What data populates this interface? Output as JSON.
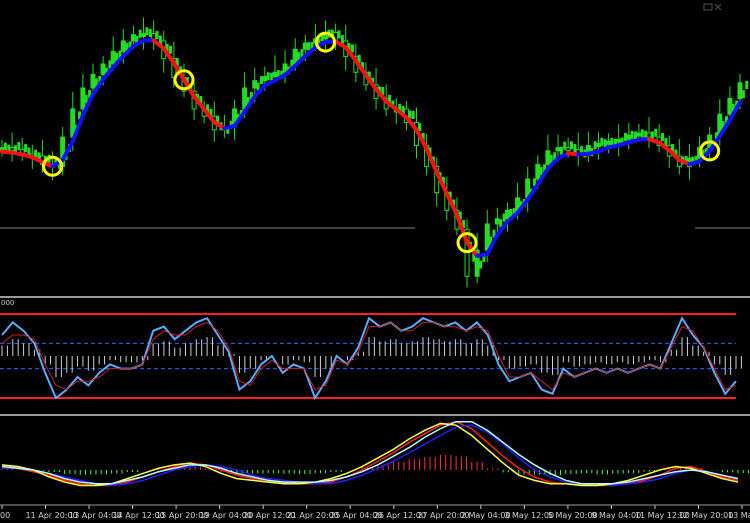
{
  "chart_data": [
    {
      "type": "candlestick",
      "panel": "price",
      "trend_line_colors": {
        "up": "#1010ff",
        "down": "#ff1010"
      },
      "candle_colors": {
        "bull": "#22dd22",
        "bear": "#22dd22"
      },
      "level_line_color": "#808080",
      "signal_marker_color": "#ffff00",
      "signal_markers_at_index": [
        5,
        18,
        32,
        46,
        70
      ],
      "series": [
        {
          "name": "close",
          "values": [
            168,
            166,
            162,
            160,
            152,
            150,
            178,
            205,
            225,
            238,
            248,
            260,
            270,
            276,
            277,
            270,
            253,
            235,
            222,
            205,
            198,
            185,
            188,
            205,
            225,
            232,
            236,
            240,
            248,
            262,
            268,
            272,
            278,
            270,
            255,
            240,
            228,
            215,
            205,
            205,
            192,
            170,
            150,
            125,
            108,
            90,
            45,
            70,
            95,
            100,
            108,
            120,
            138,
            152,
            165,
            168,
            166,
            162,
            170,
            172,
            174,
            176,
            180,
            182,
            178,
            170,
            160,
            150,
            158,
            168,
            180,
            200,
            215,
            230
          ]
        }
      ]
    },
    {
      "type": "line",
      "panel": "oscillator",
      "scale_label": "000",
      "overbought_line_color": "#ff2020",
      "dashed_level_color": "#3060ff",
      "series": [
        {
          "name": "",
          "color": "#5aaaff",
          "values": [
            0.5,
            0.8,
            0.6,
            0.3,
            -0.4,
            -1.0,
            -0.8,
            -0.5,
            -0.7,
            -0.4,
            -0.2,
            -0.3,
            -0.3,
            -0.2,
            0.6,
            0.7,
            0.4,
            0.6,
            0.8,
            0.9,
            0.5,
            0.1,
            -0.8,
            -0.6,
            -0.2,
            0.0,
            -0.4,
            -0.2,
            -0.3,
            -1.0,
            -0.6,
            0.0,
            -0.2,
            0.2,
            0.9,
            0.7,
            0.8,
            0.6,
            0.7,
            0.9,
            0.8,
            0.7,
            0.8,
            0.6,
            0.8,
            0.5,
            -0.2,
            -0.6,
            -0.5,
            -0.4,
            -0.8,
            -0.9,
            -0.3,
            -0.5,
            -0.4,
            -0.3,
            -0.4,
            -0.3,
            -0.4,
            -0.3,
            -0.2,
            -0.3,
            0.3,
            0.9,
            0.5,
            0.2,
            -0.4,
            -0.9,
            -0.6
          ]
        },
        {
          "name": "",
          "color": "#cc2020",
          "values": [
            0.3,
            0.5,
            0.5,
            0.4,
            -0.2,
            -0.7,
            -0.8,
            -0.6,
            -0.6,
            -0.5,
            -0.3,
            -0.3,
            -0.3,
            -0.2,
            0.4,
            0.6,
            0.5,
            0.5,
            0.7,
            0.8,
            0.6,
            0.2,
            -0.6,
            -0.7,
            -0.3,
            -0.1,
            -0.3,
            -0.3,
            -0.3,
            -0.8,
            -0.7,
            -0.1,
            -0.2,
            0.1,
            0.7,
            0.7,
            0.8,
            0.6,
            0.6,
            0.8,
            0.8,
            0.7,
            0.7,
            0.6,
            0.7,
            0.6,
            0.0,
            -0.5,
            -0.5,
            -0.4,
            -0.6,
            -0.8,
            -0.4,
            -0.5,
            -0.4,
            -0.3,
            -0.4,
            -0.3,
            -0.4,
            -0.3,
            -0.2,
            -0.3,
            0.2,
            0.7,
            0.6,
            0.2,
            -0.3,
            -0.8,
            -0.7
          ]
        }
      ]
    },
    {
      "type": "line",
      "panel": "macd",
      "histogram_colors": {
        "positive": "#ff3030",
        "negative": "#40ff40"
      },
      "series": [
        {
          "name": "",
          "color": "#ff2020",
          "values": [
            0.2,
            0.1,
            -0.1,
            -0.3,
            -0.6,
            -0.8,
            -0.9,
            -0.9,
            -0.7,
            -0.4,
            -0.1,
            0.2,
            0.4,
            0.3,
            0.0,
            -0.3,
            -0.5,
            -0.6,
            -0.7,
            -0.8,
            -0.8,
            -0.7,
            -0.4,
            0.0,
            0.5,
            1.0,
            1.6,
            2.1,
            2.6,
            2.8,
            2.4,
            1.6,
            0.8,
            0.1,
            -0.4,
            -0.7,
            -0.8,
            -0.8,
            -0.9,
            -0.9,
            -0.8,
            -0.6,
            -0.3,
            0.1,
            0.2,
            -0.1,
            -0.4,
            -0.6
          ]
        },
        {
          "name": "",
          "color": "#2020ff",
          "values": [
            0.1,
            0.1,
            0.0,
            -0.2,
            -0.4,
            -0.6,
            -0.8,
            -0.9,
            -0.8,
            -0.6,
            -0.3,
            0.0,
            0.2,
            0.3,
            0.2,
            0.0,
            -0.3,
            -0.5,
            -0.6,
            -0.7,
            -0.8,
            -0.8,
            -0.6,
            -0.3,
            0.1,
            0.5,
            1.0,
            1.5,
            2.0,
            2.5,
            2.6,
            2.2,
            1.5,
            0.7,
            0.0,
            -0.4,
            -0.7,
            -0.8,
            -0.8,
            -0.9,
            -0.8,
            -0.7,
            -0.5,
            -0.2,
            0.0,
            -0.1,
            -0.3,
            -0.5
          ]
        },
        {
          "name": "",
          "color": "#ffff40",
          "values": [
            0.3,
            0.2,
            0.0,
            -0.4,
            -0.7,
            -0.9,
            -0.9,
            -0.8,
            -0.5,
            -0.2,
            0.1,
            0.3,
            0.4,
            0.2,
            -0.2,
            -0.5,
            -0.6,
            -0.7,
            -0.8,
            -0.8,
            -0.7,
            -0.5,
            -0.2,
            0.2,
            0.7,
            1.2,
            1.8,
            2.3,
            2.7,
            2.6,
            2.0,
            1.2,
            0.4,
            -0.3,
            -0.6,
            -0.8,
            -0.8,
            -0.9,
            -0.9,
            -0.8,
            -0.6,
            -0.3,
            0.0,
            0.2,
            0.1,
            -0.2,
            -0.5,
            -0.7
          ]
        },
        {
          "name": "",
          "color": "#b0ffff",
          "values": [
            0.2,
            0.1,
            0.0,
            -0.2,
            -0.5,
            -0.7,
            -0.8,
            -0.8,
            -0.6,
            -0.4,
            -0.1,
            0.1,
            0.3,
            0.3,
            0.1,
            -0.2,
            -0.4,
            -0.6,
            -0.7,
            -0.7,
            -0.7,
            -0.6,
            -0.4,
            -0.1,
            0.3,
            0.8,
            1.3,
            1.9,
            2.4,
            2.8,
            2.8,
            2.3,
            1.6,
            0.9,
            0.3,
            -0.2,
            -0.6,
            -0.8,
            -0.8,
            -0.8,
            -0.7,
            -0.5,
            -0.3,
            -0.1,
            0.0,
            -0.1,
            -0.3,
            -0.5
          ]
        }
      ]
    }
  ],
  "x_axis": {
    "ticks": [
      "00",
      "11 Apr 20:00",
      "13 Apr 04:00",
      "14 Apr 12:00",
      "15 Apr 20:00",
      "19 Apr 04:00",
      "20 Apr 12:00",
      "21 Apr 20:00",
      "25 Apr 04:00",
      "26 Apr 12:00",
      "27 Apr 20:00",
      "2 May 04:00",
      "3 May 12:00",
      "5 May 20:00",
      "9 May 04:00",
      "11 May 12:00",
      "12 May 20:00",
      "13 Ma"
    ]
  },
  "colors": {
    "background": "#000000",
    "separator": "#9a9a9a",
    "axis_text": "#cfcfcf"
  }
}
